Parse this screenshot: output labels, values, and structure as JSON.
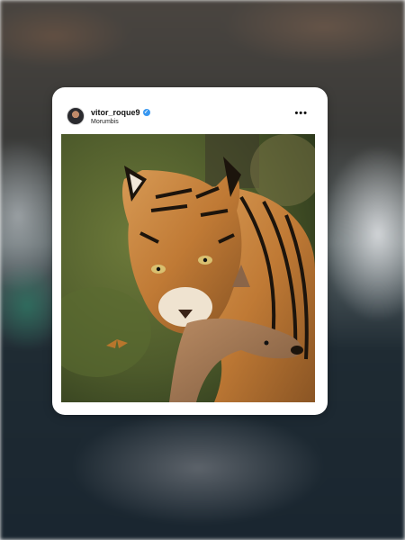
{
  "post": {
    "username": "vitor_roque9",
    "location": "Morumbis",
    "verified_icon": "verified-badge-icon",
    "more_icon": "more-options-icon",
    "more_glyph": "•••"
  },
  "colors": {
    "card_background": "#ffffff",
    "verified_blue": "#3897f0"
  }
}
